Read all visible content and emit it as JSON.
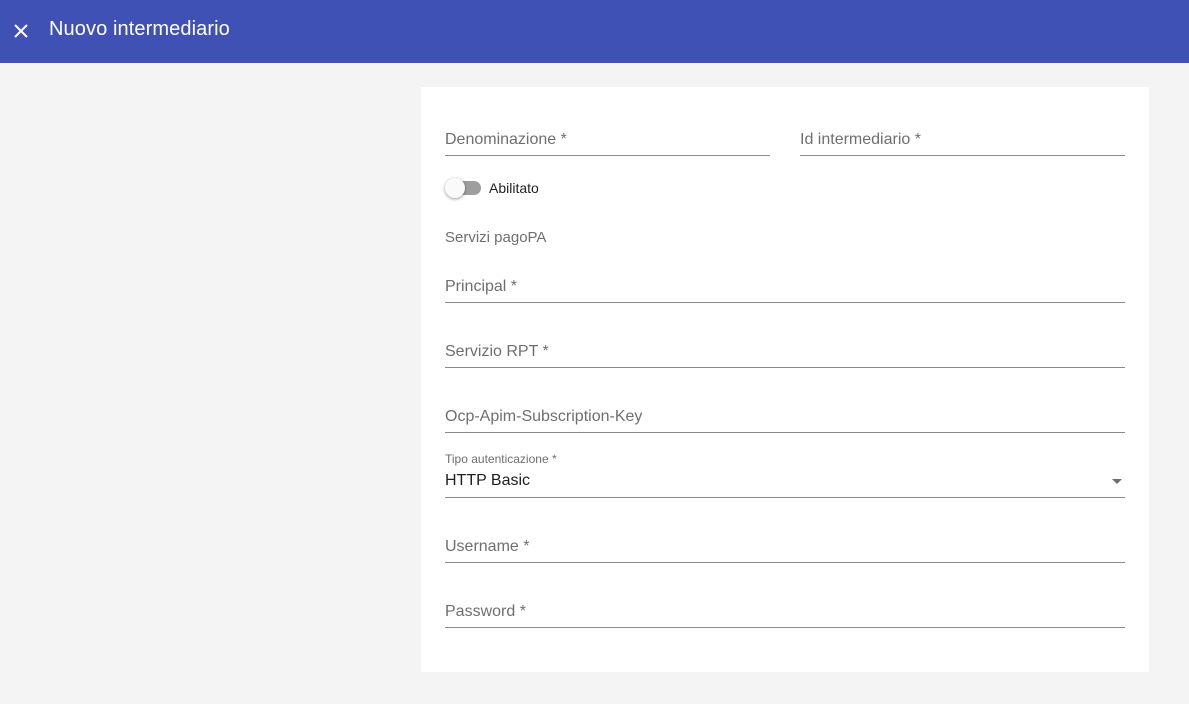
{
  "toolbar": {
    "title": "Nuovo intermediario",
    "close_icon": "close-icon",
    "background_color": "#3f51b5"
  },
  "form": {
    "denominazione_label": "Denominazione *",
    "id_intermediario_label": "Id intermediario *",
    "abilitato_label": "Abilitato",
    "abilitato_checked": false,
    "section_title": "Servizi pagoPA",
    "principal_label": "Principal *",
    "servizio_rpt_label": "Servizio RPT *",
    "subscription_key_label": "Ocp-Apim-Subscription-Key",
    "tipo_autenticazione_label": "Tipo autenticazione *",
    "tipo_autenticazione_value": "HTTP Basic",
    "username_label": "Username *",
    "password_label": "Password *"
  }
}
